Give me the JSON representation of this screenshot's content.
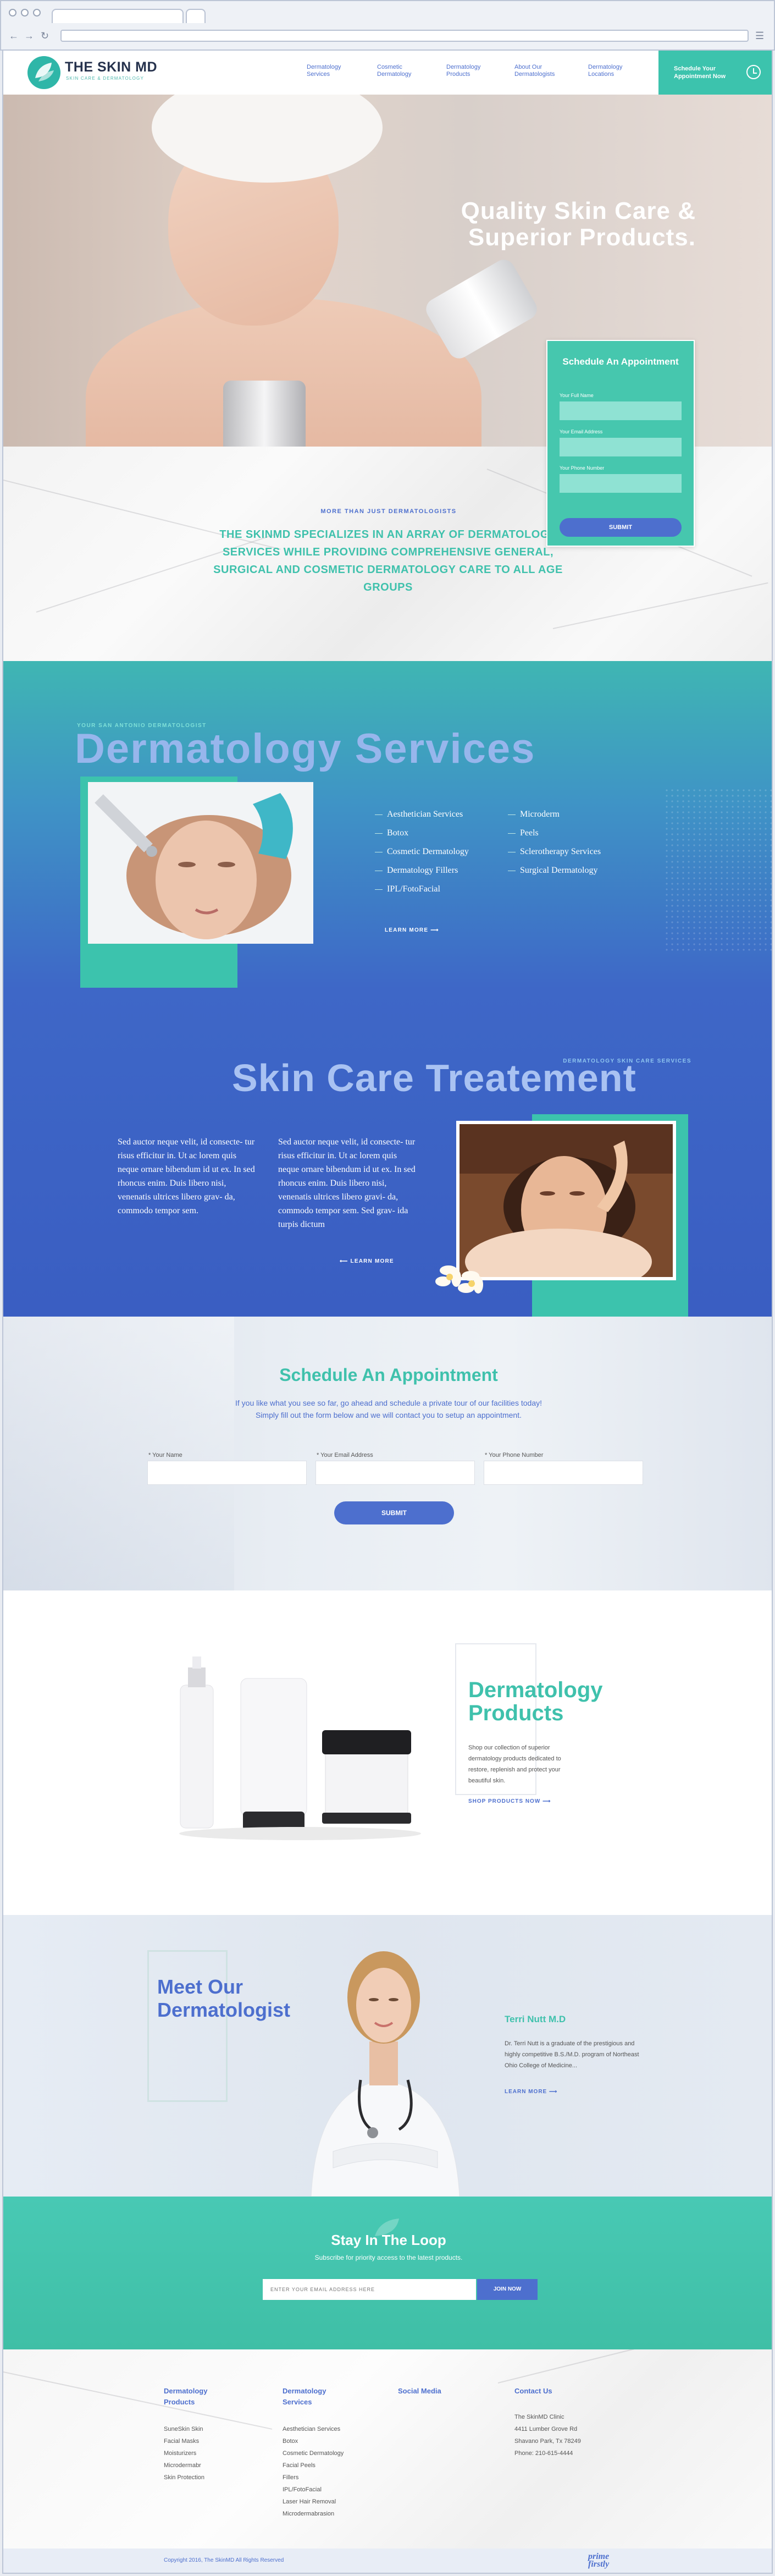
{
  "header": {
    "brand": "THE SKIN MD",
    "tagline": "SKIN CARE & DERMATOLOGY",
    "nav": [
      {
        "line1": "Dermatology",
        "line2": "Services"
      },
      {
        "line1": "Cosmetic",
        "line2": "Dermatology"
      },
      {
        "line1": "Dermatology",
        "line2": "Products"
      },
      {
        "line1": "About Our",
        "line2": "Dermatologists"
      },
      {
        "line1": "Dermatology",
        "line2": "Locations"
      }
    ],
    "cta_line1": "Schedule Your",
    "cta_line2": "Appointment Now"
  },
  "hero": {
    "title_line1": "Quality Skin Care &",
    "title_line2": "Superior Products."
  },
  "appointment_card": {
    "title": "Schedule An Appointment",
    "fields": [
      "Your Full Name",
      "Your Email Address",
      "Your Phone Number"
    ],
    "submit": "SUBMIT"
  },
  "intro": {
    "kicker": "MORE THAN JUST DERMATOLOGISTS",
    "text": "THE SKINMD SPECIALIZES IN AN ARRAY OF DERMATOLOGY SERVICES WHILE PROVIDING COMPREHENSIVE GENERAL, SURGICAL AND COSMETIC DERMATOLOGY CARE TO ALL AGE GROUPS"
  },
  "services": {
    "kicker": "YOUR SAN ANTONIO DERMATOLOGIST",
    "title": "Dermatology Services",
    "col1": [
      "Aesthetician Services",
      "Botox",
      "Cosmetic Dermatology",
      "Dermatology Fillers",
      "IPL/FotoFacial"
    ],
    "col2": [
      "Microderm",
      "Peels",
      "Sclerotherapy Services",
      "Surgical Dermatology"
    ],
    "learn_more": "LEARN MORE"
  },
  "skincare": {
    "kicker": "DERMATOLOGY SKIN CARE SERVICES",
    "title": "Skin Care Treatement",
    "para1": "Sed auctor neque velit, id consecte- tur risus efficitur in. Ut ac lorem quis neque ornare bibendum id ut ex. In sed rhoncus enim. Duis libero nisi, venenatis ultrices libero grav- da, commodo tempor sem.",
    "para2": "Sed auctor neque velit, id consecte- tur risus efficitur in. Ut ac lorem quis neque ornare bibendum id ut ex. In sed rhoncus enim. Duis libero nisi, venenatis ultrices libero gravi- da, commodo tempor sem. Sed grav- ida turpis dictum",
    "learn_more": "LEARN MORE"
  },
  "schedule": {
    "title": "Schedule An Appointment",
    "sub1": "If you like what you see so far, go ahead and schedule a private tour of our facilities today!",
    "sub2": "Simply fill out the form below and we will contact you to setup an appointment.",
    "fields": [
      "* Your Name",
      "* Your Email Address",
      "* Your Phone Number"
    ],
    "submit": "SUBMIT"
  },
  "products": {
    "title_line1": "Dermatology",
    "title_line2": "Products",
    "text": "Shop our collection of superior dermatology products dedicated to restore, replenish and protect your beautiful skin.",
    "link": "SHOP PRODUCTS NOW"
  },
  "dermatologist": {
    "title_line1": "Meet Our",
    "title_line2": "Dermatologist",
    "name": "Terri Nutt M.D",
    "text": "Dr. Terri Nutt is a graduate of the prestigious and highly competitive B.S./M.D. program of Northeast Ohio College of Medicine...",
    "link": "LEARN MORE"
  },
  "newsletter": {
    "title": "Stay In The Loop",
    "sub": "Subscribe for priority access to the latest products.",
    "placeholder": "ENTER YOUR EMAIL ADDRESS HERE",
    "button": "JOIN NOW"
  },
  "footer": {
    "col1": {
      "h1": "Dermatology",
      "h2": "Products",
      "links": [
        "SuneSkin Skin",
        "Facial Masks",
        "Moisturizers",
        "Microdermabr",
        "Skin Protection"
      ]
    },
    "col2": {
      "h1": "Dermatology",
      "h2": "Services",
      "links": [
        "Aesthetician Services",
        "Botox",
        "Cosmetic Dermatology",
        "Facial Peels",
        "Fillers",
        "IPL/FotoFacial",
        "Laser Hair Removal",
        "Microdermabrasion"
      ]
    },
    "col3": {
      "h1": "Social Media"
    },
    "col4": {
      "h1": "Contact Us",
      "links": [
        "The SkinMD Clinic",
        "4411 Lumber Grove Rd",
        "Shavano Park, Tx 78249",
        "Phone: 210-615-4444"
      ]
    },
    "copyright": "Copyright 2016, The SkinMD All Rights Reserved",
    "brand_line1": "prime",
    "brand_line2": "firstly"
  },
  "colors": {
    "teal": "#3cc3ad",
    "blue": "#4d6fce",
    "navy": "#26324d"
  }
}
